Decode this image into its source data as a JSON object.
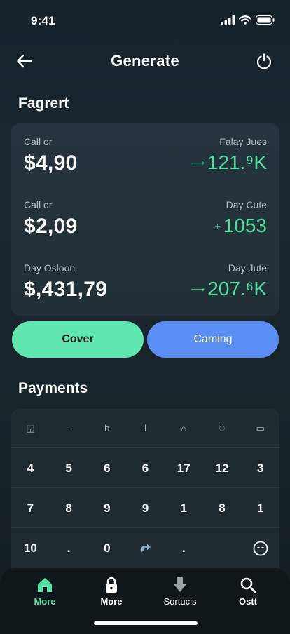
{
  "status_bar": {
    "time": "9:41"
  },
  "header": {
    "title": "Generate"
  },
  "summary": {
    "title": "Fagrert",
    "rows": [
      {
        "label": "Call or",
        "value": "$4,90",
        "right_label": "Falay Jues",
        "right_value": "121.⁹K"
      },
      {
        "label": "Call or",
        "value": "$2,09",
        "right_label": "Day Cute",
        "right_value": "1053"
      },
      {
        "label": "Day Osloon",
        "value": "$,431,79",
        "right_label": "Day Jute",
        "right_value": "207.⁶K"
      }
    ]
  },
  "actions": {
    "cover_label": "Cover",
    "camping_label": "Caming"
  },
  "payments": {
    "title": "Payments",
    "toolbar": [
      "◲",
      "-",
      "b",
      "ǀ",
      "⌂",
      "⍥",
      "▭"
    ],
    "rows": [
      [
        "4",
        "5",
        "6",
        "6",
        "17",
        "12",
        "3"
      ],
      [
        "7",
        "8",
        "9",
        "9",
        "1",
        "8",
        "1"
      ],
      [
        "10",
        ".",
        "0",
        "",
        ".",
        "",
        ""
      ]
    ]
  },
  "tabs": [
    {
      "label": "More",
      "icon": "home-icon",
      "active": true
    },
    {
      "label": "More",
      "icon": "lock-icon",
      "active": false
    },
    {
      "label": "Sortucis",
      "icon": "download-icon",
      "active": false
    },
    {
      "label": "Ostt",
      "icon": "search-icon",
      "active": false
    }
  ],
  "colors": {
    "accent_green": "#5ee6ae",
    "accent_blue": "#5a8ef5",
    "positive": "#4fe0a4"
  }
}
